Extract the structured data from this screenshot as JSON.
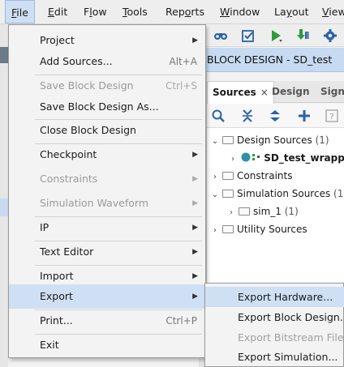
{
  "menubar": {
    "items": [
      {
        "pre": "",
        "ul": "F",
        "post": "ile"
      },
      {
        "pre": "",
        "ul": "E",
        "post": "dit"
      },
      {
        "pre": "F",
        "ul": "l",
        "post": "ow"
      },
      {
        "pre": "",
        "ul": "T",
        "post": "ools"
      },
      {
        "pre": "Rep",
        "ul": "o",
        "post": "rts"
      },
      {
        "pre": "",
        "ul": "W",
        "post": "indow"
      },
      {
        "pre": "La",
        "ul": "y",
        "post": "out"
      },
      {
        "pre": "",
        "ul": "V",
        "post": "iew"
      }
    ]
  },
  "block_design": {
    "title": "BLOCK DESIGN - SD_test"
  },
  "tabs": {
    "sources": "Sources",
    "design": "Design",
    "signals": "Signa",
    "close": "×"
  },
  "tree": {
    "design_sources": {
      "label": "Design Sources",
      "count": "(1)"
    },
    "wrapper": {
      "label": "SD_test_wrappe"
    },
    "constraints": {
      "label": "Constraints"
    },
    "simulation_sources": {
      "label": "Simulation Sources",
      "count": "(1)"
    },
    "sim_1": {
      "label": "sim_1",
      "count": "(1)"
    },
    "utility_sources": {
      "label": "Utility Sources"
    }
  },
  "file_menu": {
    "items": [
      {
        "label": "Project",
        "shortcut": "",
        "submenu": true,
        "enabled": true
      },
      {
        "label": "Add Sources...",
        "shortcut": "Alt+A",
        "submenu": false,
        "enabled": true
      },
      {
        "label": "Save Block Design",
        "shortcut": "Ctrl+S",
        "submenu": false,
        "enabled": false
      },
      {
        "label": "Save Block Design As...",
        "shortcut": "",
        "submenu": false,
        "enabled": true
      },
      {
        "label": "Close Block Design",
        "shortcut": "",
        "submenu": false,
        "enabled": true
      },
      {
        "label": "Checkpoint",
        "shortcut": "",
        "submenu": true,
        "enabled": true
      },
      {
        "label": "Constraints",
        "shortcut": "",
        "submenu": true,
        "enabled": false
      },
      {
        "label": "Simulation Waveform",
        "shortcut": "",
        "submenu": true,
        "enabled": false
      },
      {
        "label": "IP",
        "shortcut": "",
        "submenu": true,
        "enabled": true
      },
      {
        "label": "Text Editor",
        "shortcut": "",
        "submenu": true,
        "enabled": true
      },
      {
        "label": "Import",
        "shortcut": "",
        "submenu": true,
        "enabled": true
      },
      {
        "label": "Export",
        "shortcut": "",
        "submenu": true,
        "enabled": true,
        "highlighted": true
      },
      {
        "label": "Print...",
        "shortcut": "Ctrl+P",
        "submenu": false,
        "enabled": true
      },
      {
        "label": "Exit",
        "shortcut": "",
        "submenu": false,
        "enabled": true
      }
    ]
  },
  "export_submenu": {
    "items": [
      {
        "label": "Export Hardware...",
        "enabled": true,
        "highlighted": true
      },
      {
        "label": "Export Block Design...",
        "enabled": true
      },
      {
        "label": "Export Bitstream File...",
        "enabled": false
      },
      {
        "label": "Export Simulation...",
        "enabled": true
      }
    ]
  },
  "colors": {
    "menu_highlight": "#cfe0f5",
    "title_bar": "#c6daf1",
    "run_green": "#2e9b3a",
    "icon_blue": "#2a62a8"
  }
}
